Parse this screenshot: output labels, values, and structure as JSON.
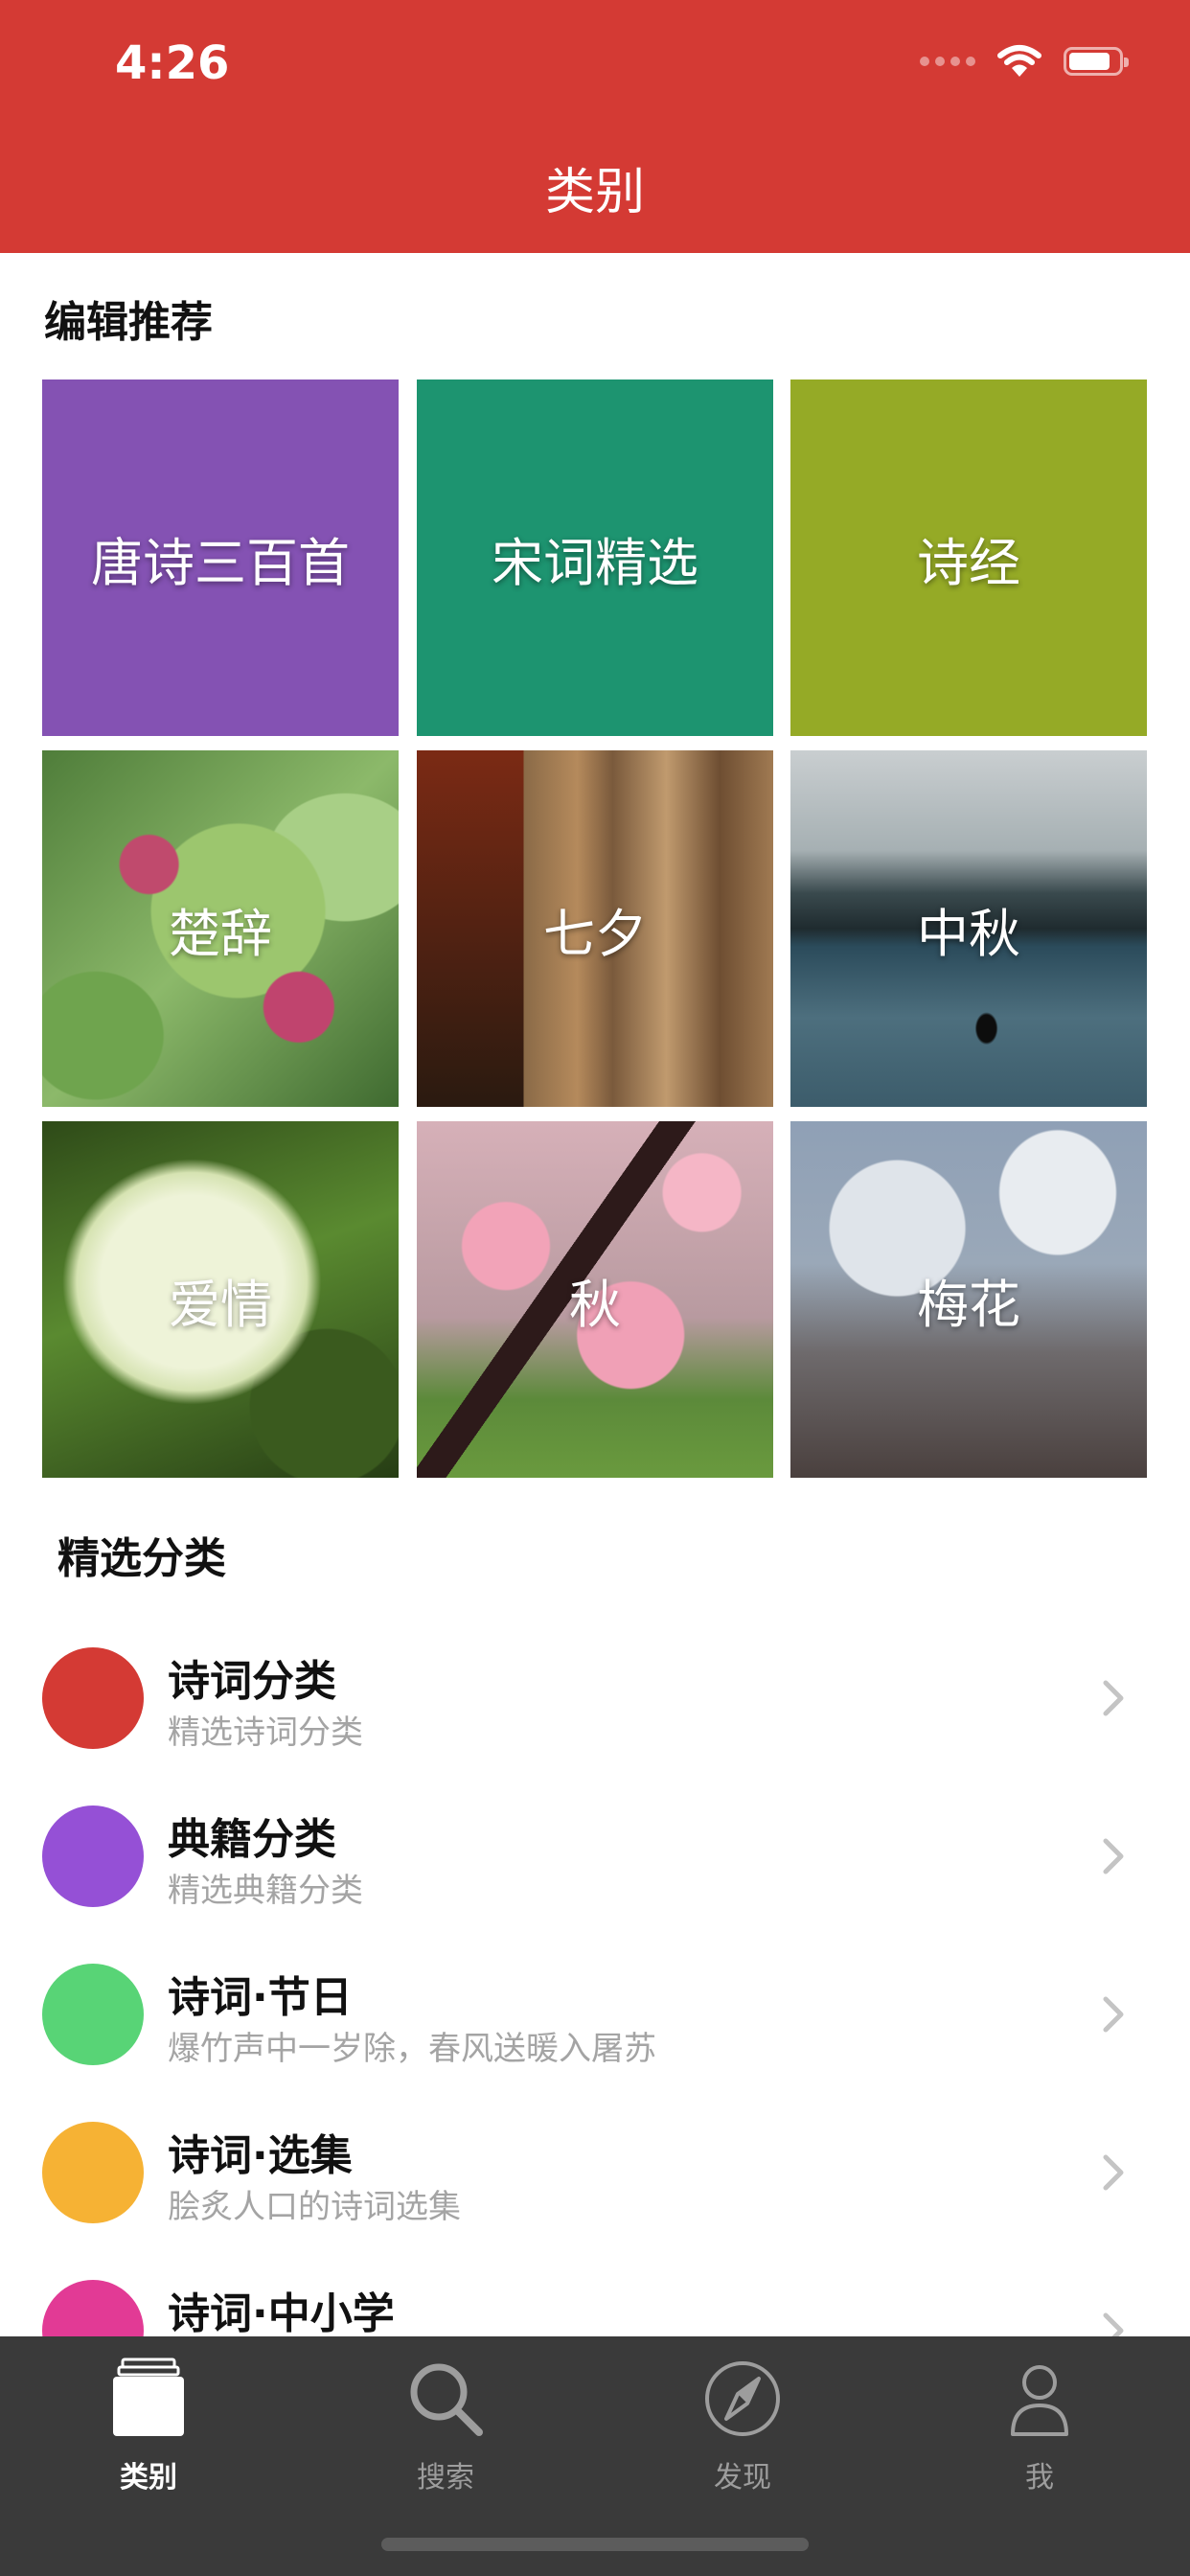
{
  "status_bar": {
    "time": "4:26"
  },
  "nav": {
    "title": "类别"
  },
  "editor_section": {
    "title": "编辑推荐",
    "tiles": [
      {
        "label": "唐诗三百首",
        "color": "#8452b3"
      },
      {
        "label": "宋词精选",
        "color": "#1d9470"
      },
      {
        "label": "诗经",
        "color": "#95aa26"
      },
      {
        "label": "楚辞",
        "image": "cotton-flower-photo"
      },
      {
        "label": "七夕",
        "image": "tree-bark-photo"
      },
      {
        "label": "中秋",
        "image": "misty-lake-photo"
      },
      {
        "label": "爱情",
        "image": "white-hydrangea-photo"
      },
      {
        "label": "秋",
        "image": "pink-blossom-photo"
      },
      {
        "label": "梅花",
        "image": "plum-branches-photo"
      }
    ]
  },
  "featured_section": {
    "title": "精选分类",
    "items": [
      {
        "title": "诗词分类",
        "subtitle": "精选诗词分类",
        "color": "#d43a34"
      },
      {
        "title": "典籍分类",
        "subtitle": "精选典籍分类",
        "color": "#9550d6"
      },
      {
        "title": "诗词·节日",
        "subtitle": "爆竹声中一岁除，春风送暖入屠苏",
        "color": "#58d476"
      },
      {
        "title": "诗词·选集",
        "subtitle": "脍炙人口的诗词选集",
        "color": "#f6b234"
      },
      {
        "title": "诗词·中小学",
        "subtitle": "",
        "color": "#e23a95"
      }
    ]
  },
  "tabbar": {
    "tabs": [
      {
        "label": "类别",
        "icon": "category-icon",
        "active": true
      },
      {
        "label": "搜索",
        "icon": "search-icon",
        "active": false
      },
      {
        "label": "发现",
        "icon": "compass-icon",
        "active": false
      },
      {
        "label": "我",
        "icon": "person-icon",
        "active": false
      }
    ]
  }
}
